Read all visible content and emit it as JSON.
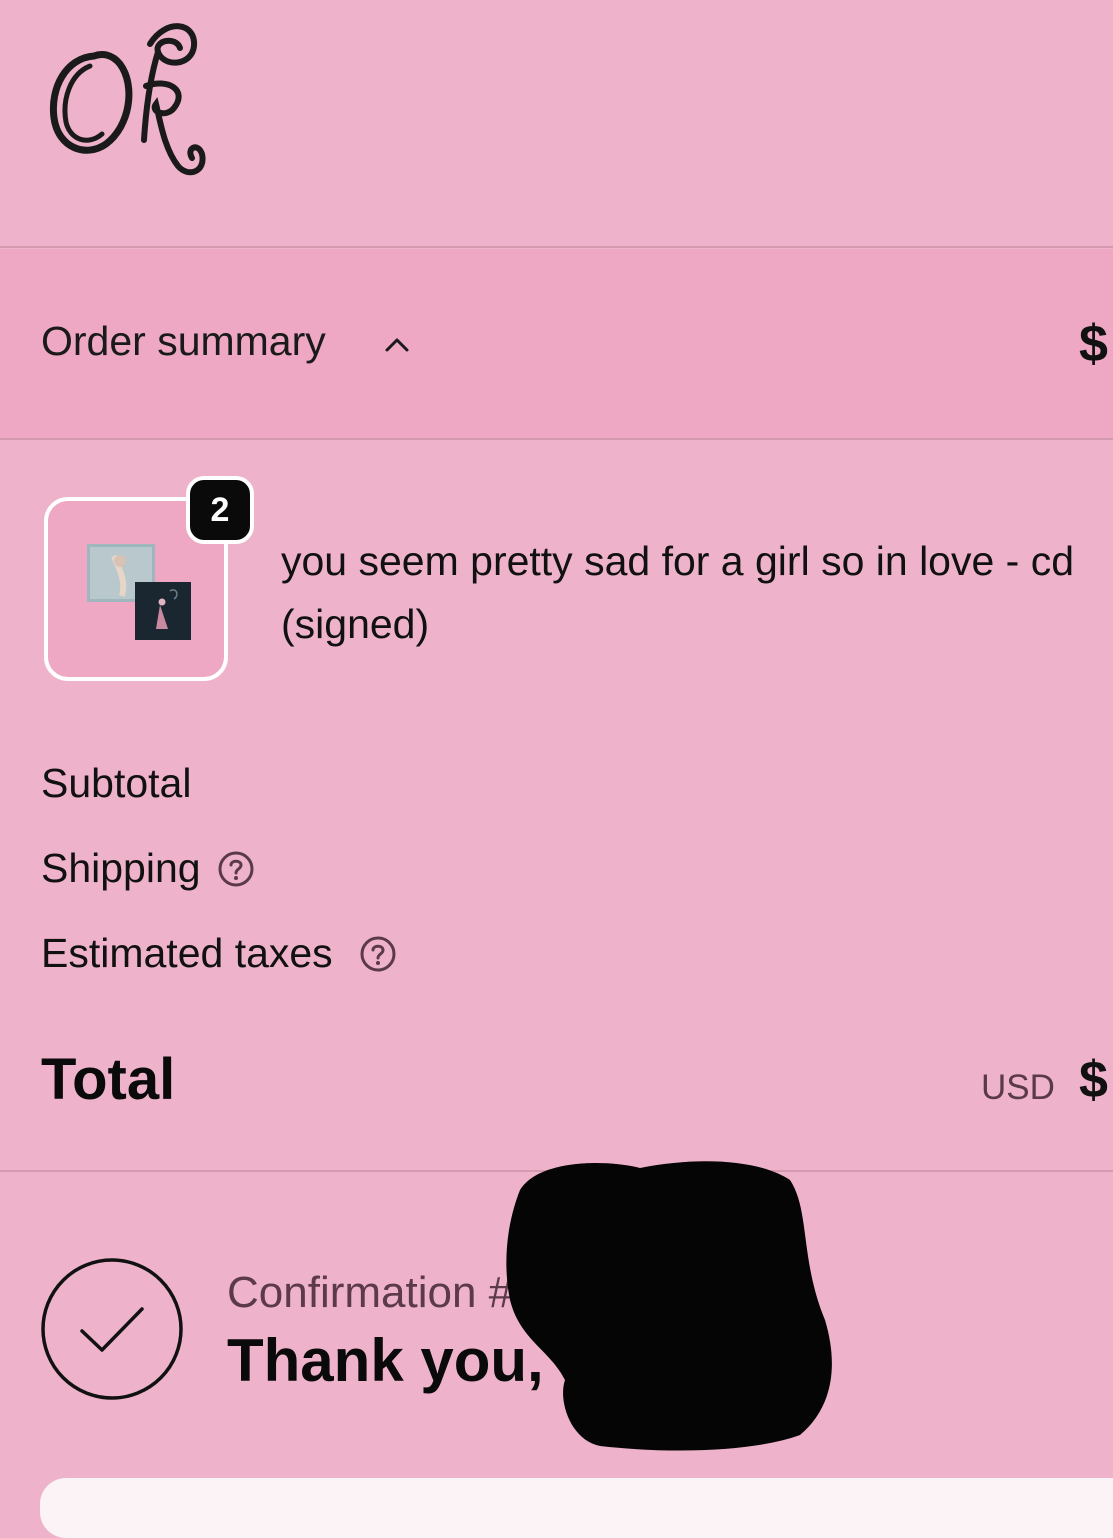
{
  "header": {
    "logo_icon": "or-monogram-logo"
  },
  "order_summary": {
    "label": "Order summary",
    "toggle_icon": "chevron-up-icon",
    "price": "$"
  },
  "line_item": {
    "title": "you seem pretty sad for a girl so in love - cd (signed)",
    "quantity": "2",
    "thumbnail_icon": "album-cd-thumbnail"
  },
  "totals": {
    "subtotal_label": "Subtotal",
    "shipping_label": "Shipping",
    "taxes_label": "Estimated taxes",
    "help_icon": "question-circle-icon",
    "total_label": "Total",
    "currency": "USD",
    "total_price": "$"
  },
  "confirmation": {
    "label": "Confirmation #",
    "thanks": "Thank you,",
    "check_icon": "checkmark-circle-icon"
  },
  "colors": {
    "background": "#eeb3ca",
    "summary_bar": "#efa8c3",
    "text": "#111111",
    "muted_text": "#5c3a4a"
  }
}
